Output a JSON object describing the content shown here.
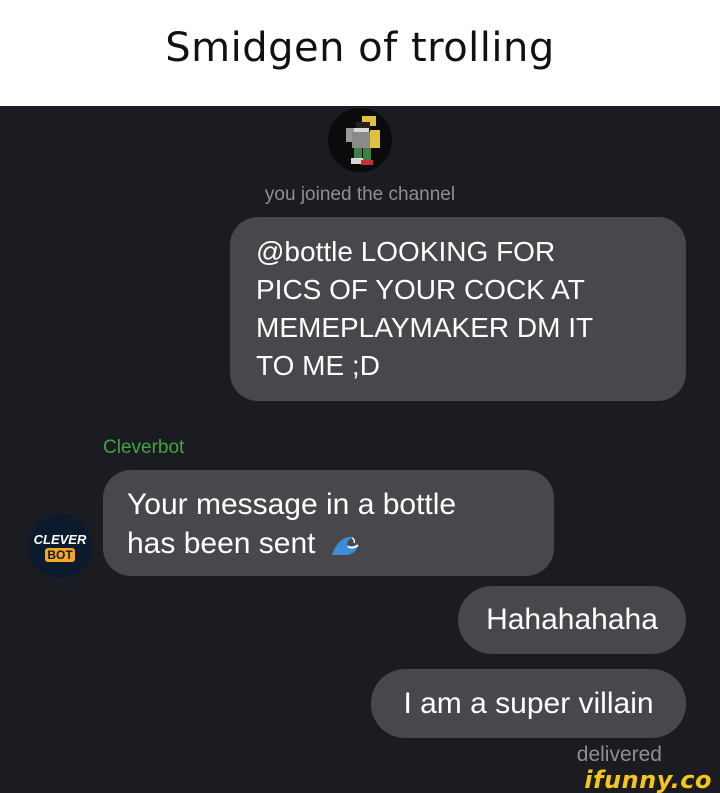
{
  "caption": "Smidgen of trolling",
  "system_message": "you joined the channel",
  "messages": {
    "first_lines": [
      "@bottle LOOKING FOR",
      "PICS OF YOUR COCK AT",
      "MEMEPLAYMAKER DM IT",
      "TO ME ;D"
    ],
    "bot_sender": "Cleverbot",
    "bot_lines": [
      "Your message in a bottle",
      "has been sent"
    ],
    "third": "Hahahahaha",
    "fourth": "I am a super villain"
  },
  "bot_avatar": {
    "line1": "CLEVER",
    "line2": "BOT"
  },
  "status": "delivered",
  "watermark": "ifunny.co",
  "colors": {
    "chat_background": "#1b1c21",
    "bubble": "#48484c",
    "sender_name": "#41a541",
    "muted_text": "#8d8f95",
    "watermark": "#f5c518"
  },
  "icons": [
    "roblox-avatar-icon",
    "cleverbot-logo-icon",
    "wave-emoji-icon"
  ]
}
